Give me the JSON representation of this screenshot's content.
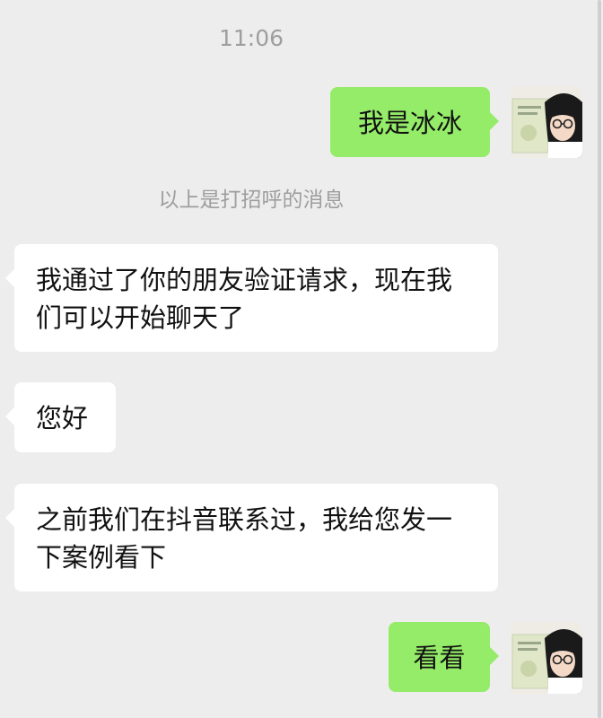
{
  "timestamp": "11:06",
  "system_notice": "以上是打招呼的消息",
  "messages": [
    {
      "side": "out",
      "text": "我是冰冰"
    },
    {
      "side": "in",
      "text": "我通过了你的朋友验证请求，现在我们可以开始聊天了"
    },
    {
      "side": "in",
      "text": "您好"
    },
    {
      "side": "in",
      "text": "之前我们在抖音联系过，我给您发一下案例看下"
    },
    {
      "side": "out",
      "text": "看看"
    }
  ],
  "avatar": {
    "icon": "user-avatar-icon",
    "description_colors": {
      "book": "#dfe7c8",
      "hair": "#1a1a1a",
      "skin": "#f3d9c6"
    }
  },
  "colors": {
    "background": "#ededed",
    "incoming_bubble": "#ffffff",
    "outgoing_bubble": "#95ec69",
    "meta_text": "#9e9e9e"
  }
}
